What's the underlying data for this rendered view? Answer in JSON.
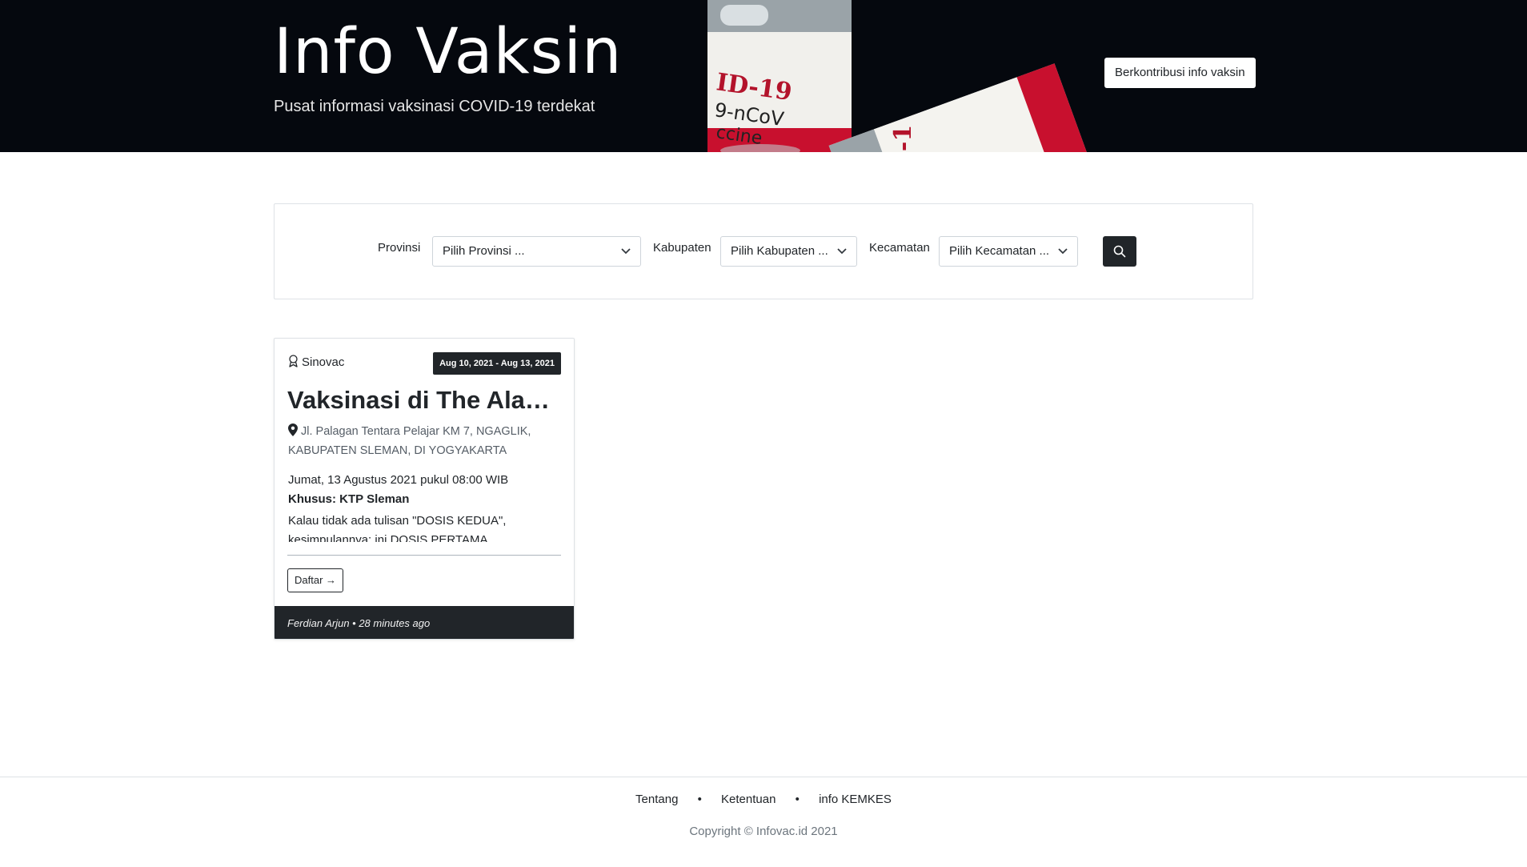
{
  "hero": {
    "title": "Info Vaksin",
    "subtitle": "Pusat informasi vaksinasi COVID-19 terdekat",
    "contribute_label": "Berkontribusi info vaksin",
    "vial_label_1": "ID-19",
    "vial_label_2": "9-nCoV",
    "vial_label_3": "ccine"
  },
  "search": {
    "provinsi_label": "Provinsi",
    "provinsi_value": "Pilih Provinsi ...",
    "kabupaten_label": "Kabupaten",
    "kabupaten_value": "Pilih Kabupaten ...",
    "kecamatan_label": "Kecamatan",
    "kecamatan_value": "Pilih Kecamatan ..."
  },
  "card": {
    "vaccine": "Sinovac",
    "date_range": "Aug 10, 2021 - Aug 13, 2021",
    "title": "Vaksinasi di The Alana Hotel",
    "address": "Jl. Palagan Tentara Pelajar KM 7, NGAGLIK, KABUPATEN SLEMAN, DI YOGYAKARTA",
    "schedule": "Jumat, 13 Agustus 2021 pukul 08:00 WIB",
    "special": "Khusus: KTP Sleman",
    "note": "Kalau tidak ada tulisan \"DOSIS KEDUA\", kesimpulannya: ini DOSIS PERTAMA",
    "register_label": "Daftar →",
    "meta": "Ferdian Arjun • 28 minutes ago"
  },
  "footer": {
    "link_about": "Tentang",
    "link_terms": "Ketentuan",
    "link_kemkes": "info KEMKES",
    "separator": "•",
    "copyright": "Copyright © Infovac.id 2021"
  },
  "colors": {
    "hero_bg": "#05080e",
    "dark": "#212529",
    "vial_red": "#c8102e"
  }
}
